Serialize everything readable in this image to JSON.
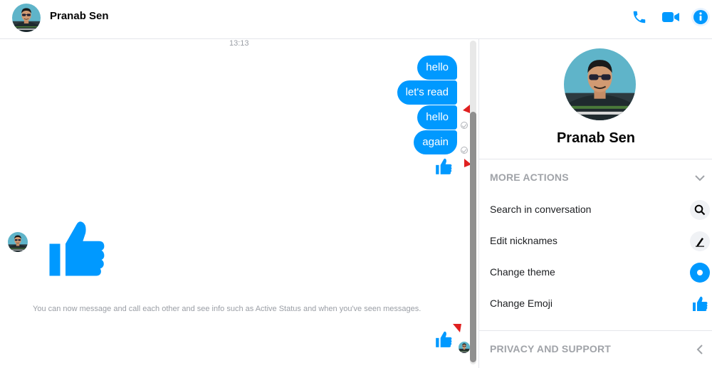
{
  "header": {
    "contact_name": "Pranab Sen",
    "icons": [
      "phone-icon",
      "video-icon",
      "info-icon"
    ],
    "accent_color": "#0099ff"
  },
  "chat": {
    "timestamp": "13:13",
    "messages": [
      {
        "text": "hello"
      },
      {
        "text": "let's read"
      },
      {
        "text": "hello"
      },
      {
        "text": "again"
      }
    ],
    "notice": "You can now message and call each other and see info such as Active Status and when you've seen messages."
  },
  "panel": {
    "name": "Pranab Sen",
    "more_actions_title": "MORE ACTIONS",
    "actions": [
      {
        "label": "Search in conversation",
        "icon": "search-icon"
      },
      {
        "label": "Edit nicknames",
        "icon": "pencil-icon"
      },
      {
        "label": "Change theme",
        "icon": "theme-icon"
      },
      {
        "label": "Change Emoji",
        "icon": "thumbs-up-icon"
      }
    ],
    "privacy_title": "PRIVACY AND SUPPORT"
  }
}
